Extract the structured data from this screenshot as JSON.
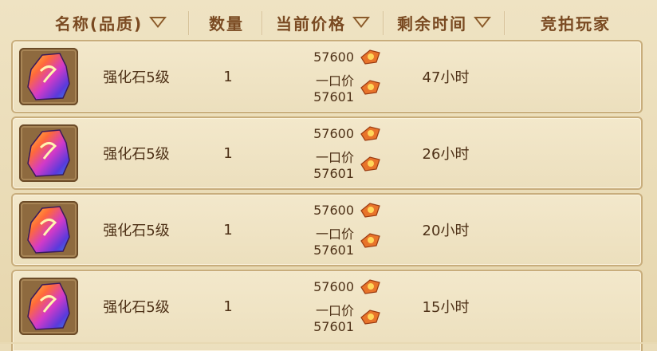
{
  "header": {
    "name_quality": "名称(品质)",
    "quantity": "数量",
    "current_price": "当前价格",
    "remaining_time": "剩余时间",
    "bidder": "竞拍玩家"
  },
  "rows": [
    {
      "name": "强化石5级",
      "quantity": "1",
      "bid_price": "57600",
      "buyout_label": "一口价",
      "buyout_price": "57601",
      "time_left": "47小时",
      "bidder": ""
    },
    {
      "name": "强化石5级",
      "quantity": "1",
      "bid_price": "57600",
      "buyout_label": "一口价",
      "buyout_price": "57601",
      "time_left": "26小时",
      "bidder": ""
    },
    {
      "name": "强化石5级",
      "quantity": "1",
      "bid_price": "57600",
      "buyout_label": "一口价",
      "buyout_price": "57601",
      "time_left": "20小时",
      "bidder": ""
    },
    {
      "name": "强化石5级",
      "quantity": "1",
      "bid_price": "57600",
      "buyout_label": "一口价",
      "buyout_price": "57601",
      "time_left": "15小时",
      "bidder": ""
    }
  ],
  "colors": {
    "header_text": "#7a4a22",
    "row_border": "#c8ad7c",
    "coin_orange": "#e8742a"
  },
  "icons": {
    "item": "rainbow-gem-icon",
    "currency": "gold-coin-ticket-icon",
    "sort": "sort-triangle-icon"
  }
}
